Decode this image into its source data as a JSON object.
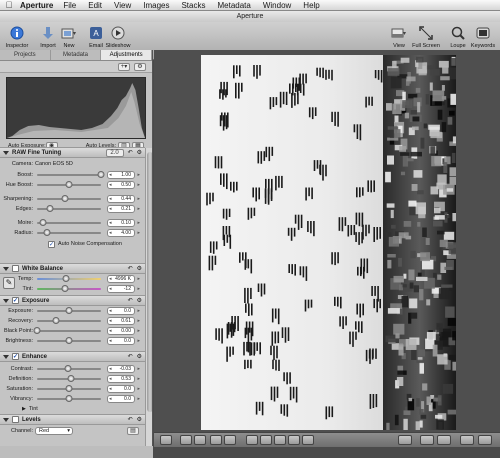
{
  "menubar": {
    "app": "Aperture",
    "items": [
      "File",
      "Edit",
      "View",
      "Images",
      "Stacks",
      "Metadata",
      "Window",
      "Help"
    ]
  },
  "window": {
    "title": "Aperture"
  },
  "toolbar": {
    "inspector": "Inspector",
    "import": "Import",
    "new": "New",
    "email": "Email",
    "slideshow": "Slideshow",
    "view": "View",
    "fullscreen": "Full Screen",
    "loupe": "Loupe",
    "keywords": "Keywords"
  },
  "inspector": {
    "tabs": [
      "Projects",
      "Metadata",
      "Adjustments"
    ],
    "active_tab": "Adjustments",
    "auto_exposure": "Auto Exposure:",
    "auto_levels": "Auto Levels:"
  },
  "raw": {
    "title": "RAW Fine Tuning",
    "version": "2.0",
    "camera_label": "Camera:",
    "camera_value": "Canon EOS 5D",
    "boost_label": "Boost:",
    "boost_value": "1.00",
    "boost_level": 1.0,
    "hue_label": "Hue Boost:",
    "hue_value": "0.50",
    "hue_level": 0.5,
    "sharp_label": "Sharpening:",
    "sharp_value": "0.44",
    "sharp_level": 0.44,
    "edges_label": "Edges:",
    "edges_value": "0.21",
    "edges_level": 0.21,
    "moire_label": "Moire:",
    "moire_value": "0.10",
    "moire_level": 0.1,
    "radius_label": "Radius:",
    "radius_value": "4.00",
    "radius_level": 0.16,
    "noise_label": "Auto Noise Compensation"
  },
  "wb": {
    "title": "White Balance",
    "temp_label": "Temp:",
    "temp_value": "4996 K",
    "temp_level": 0.45,
    "tint_label": "Tint:",
    "tint_value": "-12",
    "tint_level": 0.44
  },
  "exposure": {
    "title": "Exposure",
    "exp_label": "Exposure:",
    "exp_value": "0.0",
    "exp_level": 0.5,
    "rec_label": "Recovery:",
    "rec_value": "0.61",
    "rec_level": 0.3,
    "bp_label": "Black Point:",
    "bp_value": "0.00",
    "bp_level": 0.0,
    "br_label": "Brightness:",
    "br_value": "0.0",
    "br_level": 0.5
  },
  "enhance": {
    "title": "Enhance",
    "con_label": "Contrast:",
    "con_value": "-0.03",
    "con_level": 0.49,
    "def_label": "Definition:",
    "def_value": "0.53",
    "def_level": 0.53,
    "sat_label": "Saturation:",
    "sat_value": "0.0",
    "sat_level": 0.5,
    "vib_label": "Vibrancy:",
    "vib_value": "0.0",
    "vib_level": 0.5,
    "tint_label": "Tint"
  },
  "levels": {
    "title": "Levels",
    "channel_label": "Channel:",
    "channel_value": "Red"
  },
  "colors": {
    "accent": "#1a4ba8"
  }
}
